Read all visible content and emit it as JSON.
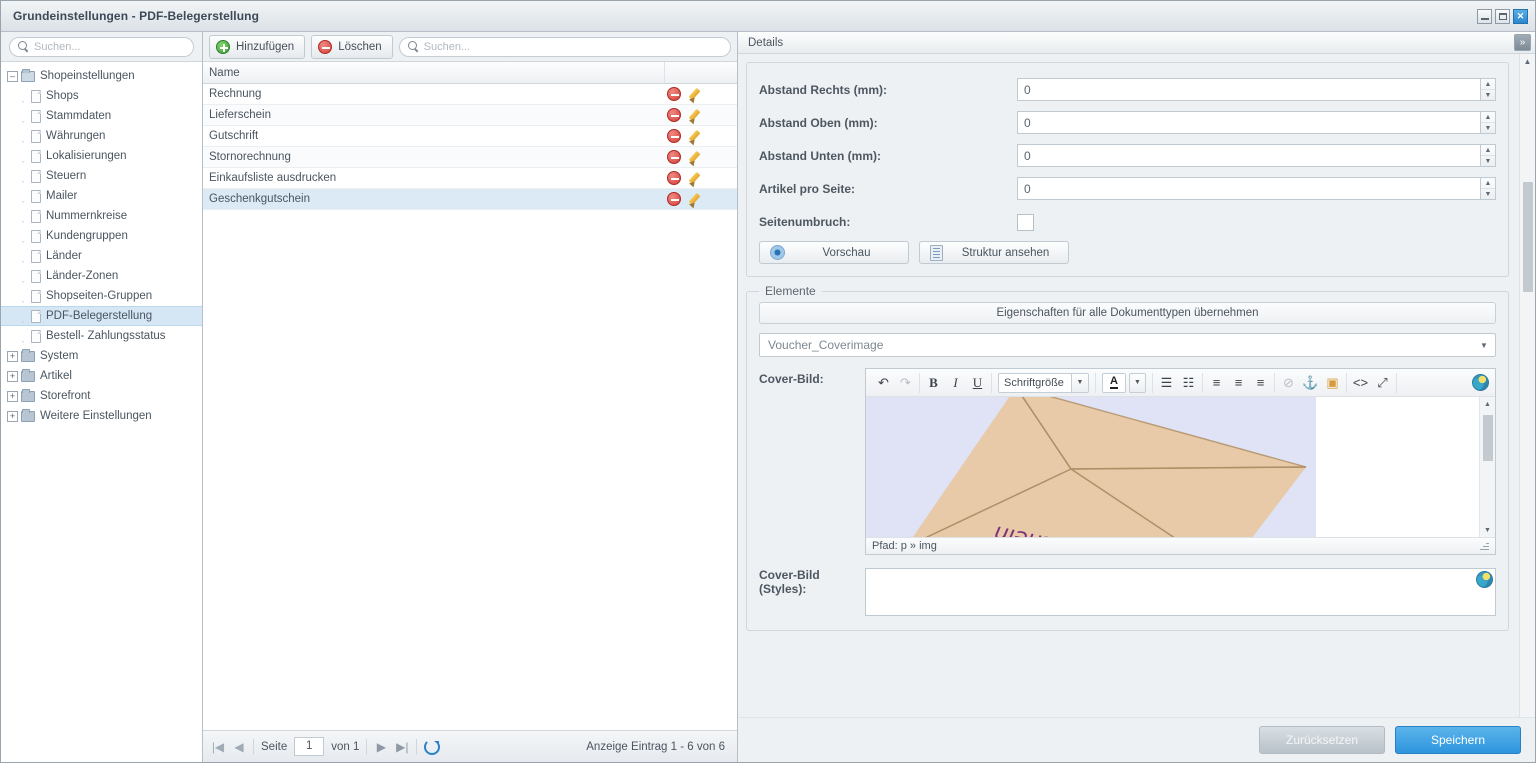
{
  "window": {
    "title": "Grundeinstellungen - PDF-Belegerstellung",
    "minimize": "–",
    "maximize": "□",
    "close": "✕"
  },
  "tree": {
    "search_placeholder": "Suchen...",
    "nodes": [
      {
        "label": "Shopeinstellungen",
        "type": "folder",
        "level": 0,
        "expander": "–",
        "selected": false
      },
      {
        "label": "Shops",
        "type": "doc",
        "level": 1,
        "selected": false
      },
      {
        "label": "Stammdaten",
        "type": "doc",
        "level": 1,
        "selected": false
      },
      {
        "label": "Währungen",
        "type": "doc",
        "level": 1,
        "selected": false
      },
      {
        "label": "Lokalisierungen",
        "type": "doc",
        "level": 1,
        "selected": false
      },
      {
        "label": "Steuern",
        "type": "doc",
        "level": 1,
        "selected": false
      },
      {
        "label": "Mailer",
        "type": "doc",
        "level": 1,
        "selected": false
      },
      {
        "label": "Nummernkreise",
        "type": "doc",
        "level": 1,
        "selected": false
      },
      {
        "label": "Kundengruppen",
        "type": "doc",
        "level": 1,
        "selected": false
      },
      {
        "label": "Länder",
        "type": "doc",
        "level": 1,
        "selected": false
      },
      {
        "label": "Länder-Zonen",
        "type": "doc",
        "level": 1,
        "selected": false
      },
      {
        "label": "Shopseiten-Gruppen",
        "type": "doc",
        "level": 1,
        "selected": false
      },
      {
        "label": "PDF-Belegerstellung",
        "type": "doc",
        "level": 1,
        "selected": true
      },
      {
        "label": "Bestell- Zahlungsstatus",
        "type": "doc",
        "level": 1,
        "selected": false
      },
      {
        "label": "System",
        "type": "folder",
        "level": 0,
        "expander": "+",
        "selected": false
      },
      {
        "label": "Artikel",
        "type": "folder",
        "level": 0,
        "expander": "+",
        "selected": false
      },
      {
        "label": "Storefront",
        "type": "folder",
        "level": 0,
        "expander": "+",
        "selected": false
      },
      {
        "label": "Weitere Einstellungen",
        "type": "folder",
        "level": 0,
        "expander": "+",
        "selected": false
      }
    ]
  },
  "grid": {
    "toolbar": {
      "add_label": "Hinzufügen",
      "delete_label": "Löschen",
      "search_placeholder": "Suchen..."
    },
    "columns": [
      "Name"
    ],
    "rows": [
      {
        "name": "Rechnung",
        "selected": false
      },
      {
        "name": "Lieferschein",
        "selected": false
      },
      {
        "name": "Gutschrift",
        "selected": false
      },
      {
        "name": "Stornorechnung",
        "selected": false
      },
      {
        "name": "Einkaufsliste ausdrucken",
        "selected": false
      },
      {
        "name": "Geschenkgutschein",
        "selected": true
      }
    ],
    "pager": {
      "first": "|◀",
      "prev": "◀",
      "page_label": "Seite",
      "page_value": "1",
      "of_label": "von 1",
      "next": "▶",
      "last": "▶|",
      "info": "Anzeige Eintrag 1 - 6 von 6"
    }
  },
  "details": {
    "header": "Details",
    "collapse_icon": "»",
    "fields": [
      {
        "label": "Abstand Rechts (mm):",
        "value": "0"
      },
      {
        "label": "Abstand Oben (mm):",
        "value": "0"
      },
      {
        "label": "Abstand Unten (mm):",
        "value": "0"
      },
      {
        "label": "Artikel pro Seite:",
        "value": "0"
      }
    ],
    "pagebreak_label": "Seitenumbruch:",
    "preview_button": "Vorschau",
    "structure_button": "Struktur ansehen",
    "elements": {
      "legend": "Elemente",
      "apply_all_button": "Eigenschaften für alle Dokumenttypen übernehmen",
      "element_select_value": "Voucher_Coverimage",
      "cover_image_label": "Cover-Bild:",
      "cover_styles_label": "Cover-Bild (Styles):",
      "editor": {
        "font_size_label": "Schriftgröße",
        "status_path": "Pfad: p » img",
        "image_text": "Gutschein",
        "icons": [
          "undo-icon",
          "redo-icon",
          "bold-icon",
          "italic-icon",
          "underline-icon",
          "font-size-select",
          "text-color-icon",
          "bullet-list-icon",
          "numbered-list-icon",
          "align-left-icon",
          "align-center-icon",
          "align-right-icon",
          "unlink-icon",
          "anchor-icon",
          "insert-image-icon",
          "source-code-icon",
          "fullscreen-icon",
          "globe-icon"
        ]
      }
    }
  },
  "footer": {
    "reset_label": "Zurücksetzen",
    "save_label": "Speichern"
  },
  "colors": {
    "accent": "#2d95de",
    "selection": "#dceaf6",
    "danger": "#d34038",
    "success": "#3da13a"
  }
}
